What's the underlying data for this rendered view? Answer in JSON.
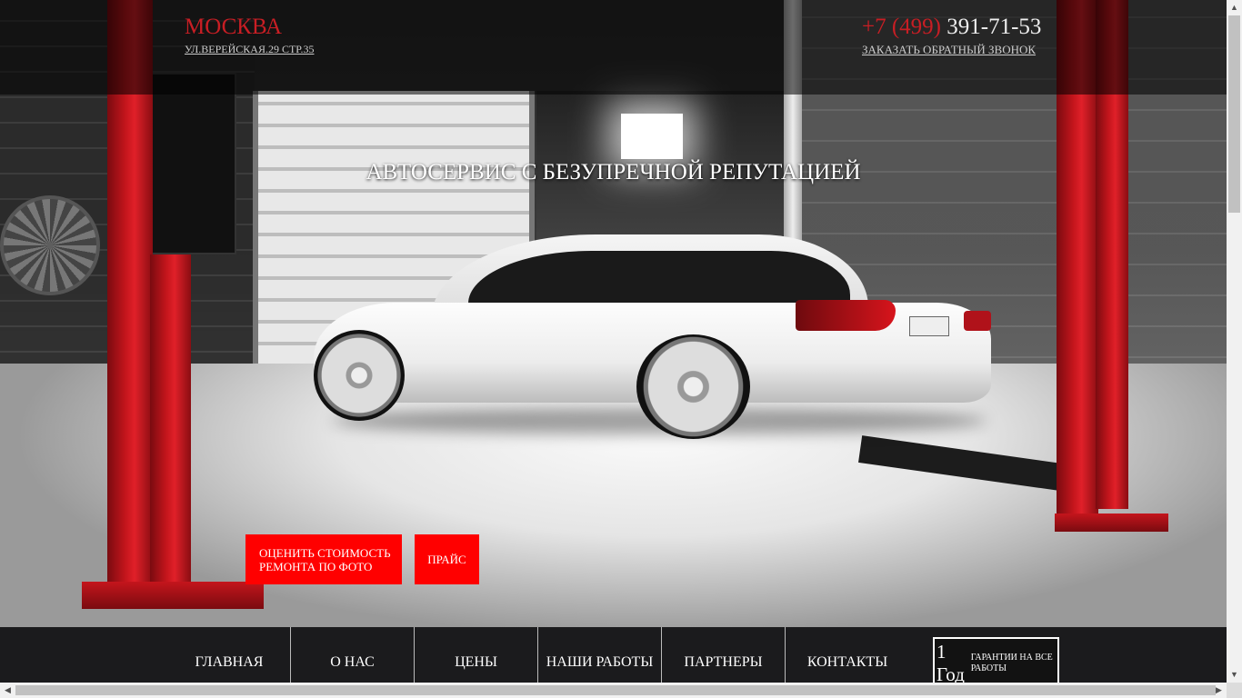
{
  "header": {
    "city": "МОСКВА",
    "address": "УЛ.ВЕРЕЙСКАЯ.29 СТР.35",
    "phone_code": "+7 (499)",
    "phone_number": "391-71-53",
    "callback_link": "ЗАКАЗАТЬ ОБРАТНЫЙ ЗВОНОК"
  },
  "hero": {
    "headline": "АВТОСЕРВИС С БЕЗУПРЕЧНОЙ РЕПУТАЦИЕЙ",
    "estimate_button": "ОЦЕНИТЬ СТОИМОСТЬ РЕМОНТА ПО ФОТО",
    "price_button": "ПРАЙС"
  },
  "nav": {
    "items": [
      "ГЛАВНАЯ",
      "О НАС",
      "ЦЕНЫ",
      "НАШИ РАБОТЫ",
      "ПАРТНЕРЫ",
      "КОНТАКТЫ"
    ]
  },
  "warranty": {
    "big": "1 Год",
    "small": "ГАРАНТИИ НА ВСЕ РАБОТЫ"
  },
  "colors": {
    "accent_red": "#ff0000",
    "brand_red": "#c81e24",
    "nav_bg": "#1b1b1d"
  },
  "icons": {
    "scroll_up": "▲",
    "scroll_down": "▼",
    "scroll_left": "◀",
    "scroll_right": "▶"
  }
}
